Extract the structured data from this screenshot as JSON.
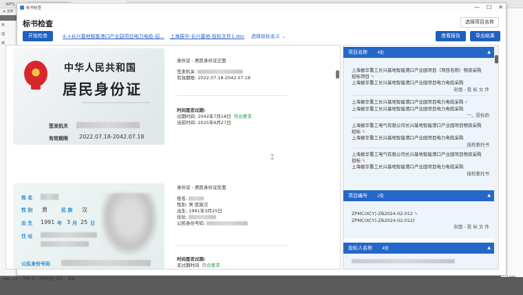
{
  "background": {
    "tabs": [
      "WPS",
      "",
      "",
      "标书检查"
    ],
    "menu": "≡ 文件",
    "leftnav": [
      "布",
      "插",
      "离"
    ],
    "status": [
      "页面: 1/1",
      "字数: 9",
      "拼写检查: 关闭",
      "校对"
    ],
    "zoom": "120%"
  },
  "dialog": {
    "window_title": "标书检查",
    "title": "标书检查",
    "project_name_button": "选择项目名称",
    "start_button": "开始检查",
    "file1": "4.+长兴基地智能港口产业园项目电力电缆-招...",
    "file2": "上海振华-长兴基地-投标文件1.doc",
    "select_signature": "选择投标名义",
    "view_report_button": "查看报告",
    "export_button": "导出结果"
  },
  "id_front": {
    "country": "中华人民共和国",
    "card_type": "居民身份证",
    "authority_label": "签发机关",
    "validity_label": "有效期限",
    "validity_value": "2022.07.18-2042.07.18"
  },
  "id_back": {
    "name_label": "姓 名",
    "gender_label": "性 别",
    "gender_value": "男",
    "ethnicity_label": "民 族",
    "ethnicity_value": "汉",
    "birth_label": "出 生",
    "birth_year": "1991",
    "birth_year_unit": "年",
    "birth_month": "3",
    "birth_month_unit": "月",
    "birth_day": "25",
    "birth_day_unit": "日",
    "address_label": "住 址",
    "id_label": "公民身份号码"
  },
  "info_front": {
    "section": "身份证 - 居民身份证正面",
    "authority": "签发机关:",
    "validity": "有效期限: 2022.07.18-2042.07.18",
    "expired_title": "时间是否过期:",
    "expire_time": "过期时间: 2042年7月18日",
    "ok": "符合要求",
    "current_time": "当前时间: 2025年6月27日"
  },
  "info_back": {
    "section": "身份证 - 居民身份证反面",
    "name": "姓名:",
    "gender": "性别: 男 民族汉",
    "birth": "出生: 1991年3月25日",
    "address": "住址:",
    "id_number": "公民身份号码:",
    "expired_title": "时间是否过期:",
    "no_expire": "无过期时间",
    "ok": "符合要求"
  },
  "right": {
    "project_name": {
      "title": "项目名称",
      "count": "4处",
      "items": [
        {
          "line1": "上海振华重工长兴基地智能港口产业园项目（项目名称）物资采购",
          "line2": "招标项目",
          "line3": "上海振华重工长兴基地智能港口产业园项目电力电缆采购",
          "source": "封面 - 投 标 文 件"
        },
        {
          "line1": "上海振华重工长兴基地智能港口产业园项目电力电缆采购",
          "line2": "上海振华重工长兴基地智能港口产业园项目电力电缆采购",
          "line3": "",
          "source": "一、投标函"
        },
        {
          "line1": "上海振华重工电气有限公司长兴基地智能港口产业园项目物资采购",
          "line2": "招标",
          "line3": "上海振华重工长兴基地智能港口产业园项目电力电缆采购",
          "source": "授权委托书"
        },
        {
          "line1": "上海振华重工电气有限公司长兴基地智能港口产业园项目物资采购",
          "line2": "招标",
          "line3": "上海振华重工长兴基地智能港口产业园项目电力电缆采购",
          "source": "授权委托书"
        }
      ]
    },
    "project_number": {
      "title": "项目编号",
      "count": "2处",
      "line1": "ZPMC(XCY)-ZB2024-02-012",
      "line2": "ZPMC(XCY)-ZB2024-02-012)",
      "source": "封面 - 投 标 文 件"
    },
    "bidder_name": {
      "title": "投标人名称",
      "count": "4处"
    }
  }
}
